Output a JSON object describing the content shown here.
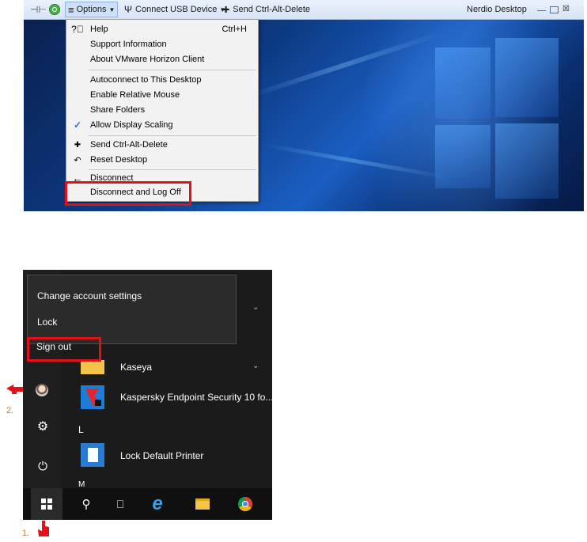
{
  "toolbar": {
    "options_label": "Options",
    "usb_label": "Connect USB Device",
    "cad_label": "Send Ctrl-Alt-Delete",
    "desktop_name": "Nerdio Desktop"
  },
  "options_menu": {
    "items": [
      {
        "label": "Help",
        "shortcut": "Ctrl+H"
      },
      {
        "label": "Support Information"
      },
      {
        "label": "About VMware Horizon Client"
      },
      {
        "label": "Autoconnect to This Desktop"
      },
      {
        "label": "Enable Relative Mouse"
      },
      {
        "label": "Share Folders"
      },
      {
        "label": "Allow Display Scaling",
        "checked": true
      },
      {
        "label": "Send Ctrl-Alt-Delete"
      },
      {
        "label": "Reset Desktop"
      },
      {
        "label": "Disconnect"
      },
      {
        "label": "Disconnect and Log Off",
        "highlighted": true
      }
    ]
  },
  "start_menu": {
    "account_menu": {
      "items": [
        "Change account settings",
        "Lock",
        "Sign out"
      ]
    },
    "apps": [
      {
        "label": "Kaseya"
      },
      {
        "label": "Kaspersky Endpoint Security 10 fo..."
      },
      {
        "label": "Lock Default Printer"
      }
    ],
    "letters": [
      "L",
      "M"
    ]
  },
  "annotations": {
    "step1": "1.",
    "step2": "2."
  },
  "colors": {
    "highlight_box": "#e3101a",
    "annotation_text": "#e07a10",
    "start_accent": "#2a7bd3"
  }
}
